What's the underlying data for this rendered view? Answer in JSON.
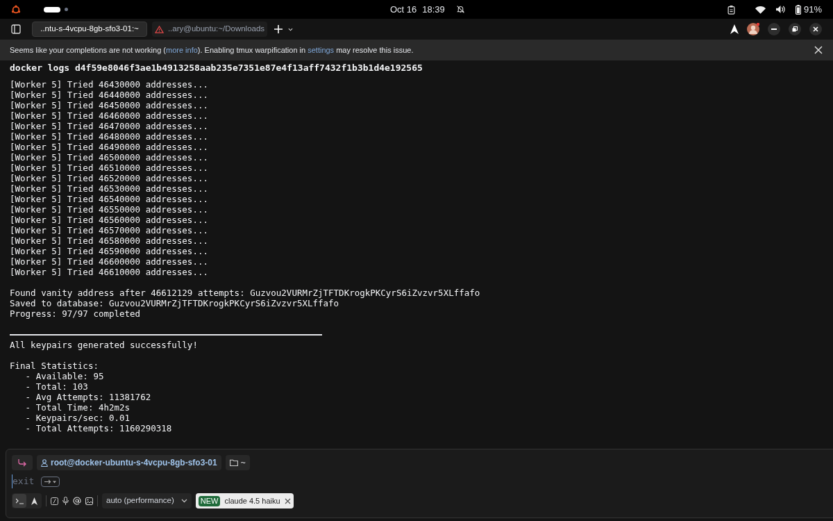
{
  "top_bar": {
    "date": "Oct 16",
    "time": "18:39",
    "battery": "91%"
  },
  "tabs": [
    {
      "label": "..ntu-s-4vcpu-8gb-sfo3-01:~",
      "selected": true,
      "warning": false
    },
    {
      "label": "..ary@ubuntu:~/Downloads",
      "selected": false,
      "warning": true
    }
  ],
  "banner": {
    "parts": [
      {
        "kind": "text",
        "text": "Seems like your completions are not working ("
      },
      {
        "kind": "link",
        "text": "more info"
      },
      {
        "kind": "text",
        "text": "). Enabling tmux warpification in "
      },
      {
        "kind": "link",
        "text": "settings"
      },
      {
        "kind": "text",
        "text": " may resolve this issue."
      }
    ]
  },
  "command": "docker logs d4f59e8046f3ae1b4913258aab235e7351e87e4f13aff7432f1b3b1d4e192565",
  "output": [
    {
      "kind": "line",
      "text": "[Worker 5] Tried 46430000 addresses..."
    },
    {
      "kind": "line",
      "text": "[Worker 5] Tried 46440000 addresses..."
    },
    {
      "kind": "line",
      "text": "[Worker 5] Tried 46450000 addresses..."
    },
    {
      "kind": "line",
      "text": "[Worker 5] Tried 46460000 addresses..."
    },
    {
      "kind": "line",
      "text": "[Worker 5] Tried 46470000 addresses..."
    },
    {
      "kind": "line",
      "text": "[Worker 5] Tried 46480000 addresses..."
    },
    {
      "kind": "line",
      "text": "[Worker 5] Tried 46490000 addresses..."
    },
    {
      "kind": "line",
      "text": "[Worker 5] Tried 46500000 addresses..."
    },
    {
      "kind": "line",
      "text": "[Worker 5] Tried 46510000 addresses..."
    },
    {
      "kind": "line",
      "text": "[Worker 5] Tried 46520000 addresses..."
    },
    {
      "kind": "line",
      "text": "[Worker 5] Tried 46530000 addresses..."
    },
    {
      "kind": "line",
      "text": "[Worker 5] Tried 46540000 addresses..."
    },
    {
      "kind": "line",
      "text": "[Worker 5] Tried 46550000 addresses..."
    },
    {
      "kind": "line",
      "text": "[Worker 5] Tried 46560000 addresses..."
    },
    {
      "kind": "line",
      "text": "[Worker 5] Tried 46570000 addresses..."
    },
    {
      "kind": "line",
      "text": "[Worker 5] Tried 46580000 addresses..."
    },
    {
      "kind": "line",
      "text": "[Worker 5] Tried 46590000 addresses..."
    },
    {
      "kind": "line",
      "text": "[Worker 5] Tried 46600000 addresses..."
    },
    {
      "kind": "line",
      "text": "[Worker 5] Tried 46610000 addresses..."
    },
    {
      "kind": "gap"
    },
    {
      "kind": "line",
      "text": "Found vanity address after 46612129 attempts: Guzvou2VURMrZjTFTDKrogkPKCyrS6iZvzvr5XLffafo"
    },
    {
      "kind": "line",
      "text": "Saved to database: Guzvou2VURMrZjTFTDKrogkPKCyrS6iZvzvr5XLffafo"
    },
    {
      "kind": "line",
      "text": "Progress: 97/97 completed"
    },
    {
      "kind": "gap"
    },
    {
      "kind": "rule"
    },
    {
      "kind": "line",
      "text": "All keypairs generated successfully!"
    },
    {
      "kind": "gap"
    },
    {
      "kind": "line",
      "text": "Final Statistics:"
    },
    {
      "kind": "line",
      "text": "   - Available: 95"
    },
    {
      "kind": "line",
      "text": "   - Total: 103"
    },
    {
      "kind": "line",
      "text": "   - Avg Attempts: 11381762"
    },
    {
      "kind": "line",
      "text": "   - Total Time: 4h2m2s"
    },
    {
      "kind": "line",
      "text": "   - Keypairs/sec: 0.01"
    },
    {
      "kind": "line",
      "text": "   - Total Attempts: 1160290318"
    }
  ],
  "prompt": {
    "modes": [
      {
        "kind": "terminal",
        "selected": true
      },
      {
        "kind": "agent",
        "selected": false
      }
    ],
    "user_host": "root@docker-ubuntu-s-4vcpu-8gb-sfo3-01",
    "directory": "~",
    "input": "exit",
    "model_mode": "auto (performance)",
    "new_badge": "NEW",
    "new_model": "claude 4.5 haiku"
  }
}
